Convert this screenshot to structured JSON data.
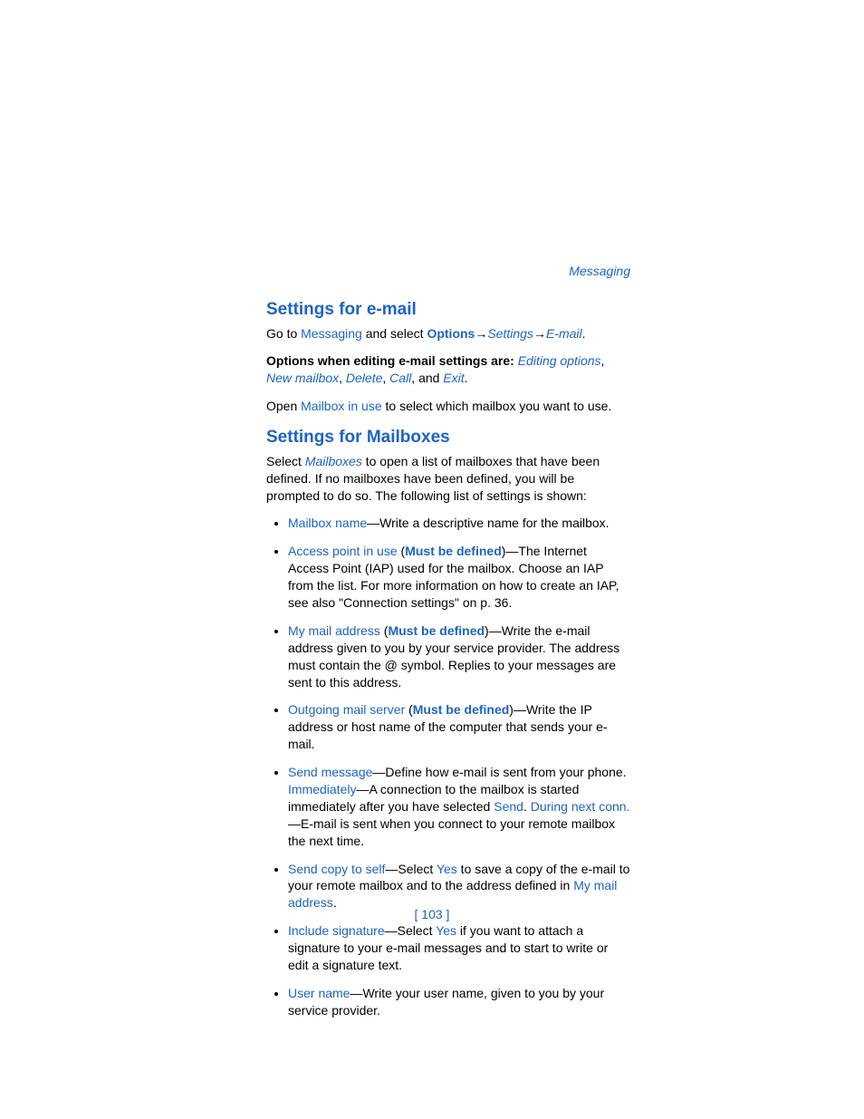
{
  "headerLabel": "Messaging",
  "section1": {
    "title": "Settings for e-mail",
    "intro": {
      "pre": "Go to ",
      "messaging": "Messaging",
      "mid1": " and select ",
      "options": "Options",
      "settings": "Settings",
      "email": "E-mail",
      "period": "."
    },
    "opts": {
      "pre": "Options when editing e-mail settings are: ",
      "editing": "Editing options",
      "newmailbox": "New mailbox",
      "delete": "Delete",
      "call": "Call",
      "exit": "Exit",
      "and": ", and ",
      "comma": ", ",
      "period": "."
    },
    "open": {
      "pre": "Open ",
      "mailbox": "Mailbox in use",
      "post": " to select which mailbox you want to use."
    }
  },
  "section2": {
    "title": "Settings for Mailboxes",
    "intro": {
      "pre": "Select ",
      "mailboxes": "Mailboxes",
      "post": " to open a list of mailboxes that have been defined. If no mailboxes have been defined, you will be prompted to do so. The following list of settings is shown:"
    },
    "items": {
      "mailboxName": {
        "term": "Mailbox name",
        "post": "—Write a descriptive name for the mailbox."
      },
      "accessPoint": {
        "term": "Access point in use",
        "must": "Must be defined",
        "post": "—The Internet Access Point (IAP) used for the mailbox. Choose an IAP from the list. For more information on how to create an IAP, see also \"Connection settings\" on p. 36."
      },
      "myMail": {
        "term": "My mail address",
        "must": "Must be defined",
        "post": "—Write the e-mail address given to you by your service provider. The address must contain the @ symbol. Replies to your messages are sent to this address."
      },
      "outgoing": {
        "term": "Outgoing mail server",
        "must": "Must be defined",
        "post": "—Write the IP address or host name of the computer that sends your e-mail."
      },
      "sendMessage": {
        "term": "Send message",
        "post1": "—Define how e-mail is sent from your phone. ",
        "immediately": "Immediately",
        "post2": "—A connection to the mailbox is started immediately after you have selected ",
        "send": "Send",
        "period": ". ",
        "during": "During next conn.",
        "post3": "—E-mail is sent when you connect to your remote mailbox the next time."
      },
      "sendCopy": {
        "term": "Send copy to self",
        "post1": "—Select ",
        "yes": "Yes",
        "post2": " to save a copy of the e-mail to your remote mailbox and to the address defined in ",
        "mymail": "My mail address",
        "period": "."
      },
      "includeSig": {
        "term": "Include signature",
        "post1": "—Select ",
        "yes": "Yes",
        "post2": " if you want to attach a signature to your e-mail messages and to start to write or edit a signature text."
      },
      "userName": {
        "term": "User name",
        "post": "—Write your user name, given to you by your service provider."
      }
    }
  },
  "pageNumber": "[ 103 ]",
  "openParen": " (",
  "closeParen": ")",
  "arrow": "→ "
}
